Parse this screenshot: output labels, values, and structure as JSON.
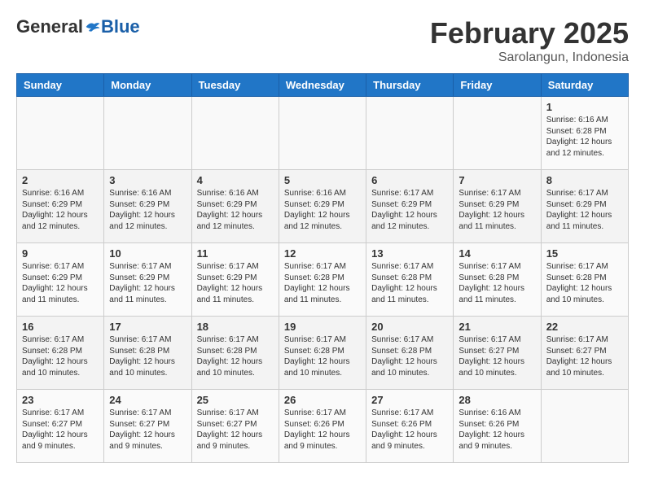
{
  "logo": {
    "general": "General",
    "blue": "Blue"
  },
  "header": {
    "month": "February 2025",
    "location": "Sarolangun, Indonesia"
  },
  "weekdays": [
    "Sunday",
    "Monday",
    "Tuesday",
    "Wednesday",
    "Thursday",
    "Friday",
    "Saturday"
  ],
  "weeks": [
    [
      {
        "day": "",
        "info": ""
      },
      {
        "day": "",
        "info": ""
      },
      {
        "day": "",
        "info": ""
      },
      {
        "day": "",
        "info": ""
      },
      {
        "day": "",
        "info": ""
      },
      {
        "day": "",
        "info": ""
      },
      {
        "day": "1",
        "info": "Sunrise: 6:16 AM\nSunset: 6:28 PM\nDaylight: 12 hours\nand 12 minutes."
      }
    ],
    [
      {
        "day": "2",
        "info": "Sunrise: 6:16 AM\nSunset: 6:29 PM\nDaylight: 12 hours\nand 12 minutes."
      },
      {
        "day": "3",
        "info": "Sunrise: 6:16 AM\nSunset: 6:29 PM\nDaylight: 12 hours\nand 12 minutes."
      },
      {
        "day": "4",
        "info": "Sunrise: 6:16 AM\nSunset: 6:29 PM\nDaylight: 12 hours\nand 12 minutes."
      },
      {
        "day": "5",
        "info": "Sunrise: 6:16 AM\nSunset: 6:29 PM\nDaylight: 12 hours\nand 12 minutes."
      },
      {
        "day": "6",
        "info": "Sunrise: 6:17 AM\nSunset: 6:29 PM\nDaylight: 12 hours\nand 12 minutes."
      },
      {
        "day": "7",
        "info": "Sunrise: 6:17 AM\nSunset: 6:29 PM\nDaylight: 12 hours\nand 11 minutes."
      },
      {
        "day": "8",
        "info": "Sunrise: 6:17 AM\nSunset: 6:29 PM\nDaylight: 12 hours\nand 11 minutes."
      }
    ],
    [
      {
        "day": "9",
        "info": "Sunrise: 6:17 AM\nSunset: 6:29 PM\nDaylight: 12 hours\nand 11 minutes."
      },
      {
        "day": "10",
        "info": "Sunrise: 6:17 AM\nSunset: 6:29 PM\nDaylight: 12 hours\nand 11 minutes."
      },
      {
        "day": "11",
        "info": "Sunrise: 6:17 AM\nSunset: 6:29 PM\nDaylight: 12 hours\nand 11 minutes."
      },
      {
        "day": "12",
        "info": "Sunrise: 6:17 AM\nSunset: 6:28 PM\nDaylight: 12 hours\nand 11 minutes."
      },
      {
        "day": "13",
        "info": "Sunrise: 6:17 AM\nSunset: 6:28 PM\nDaylight: 12 hours\nand 11 minutes."
      },
      {
        "day": "14",
        "info": "Sunrise: 6:17 AM\nSunset: 6:28 PM\nDaylight: 12 hours\nand 11 minutes."
      },
      {
        "day": "15",
        "info": "Sunrise: 6:17 AM\nSunset: 6:28 PM\nDaylight: 12 hours\nand 10 minutes."
      }
    ],
    [
      {
        "day": "16",
        "info": "Sunrise: 6:17 AM\nSunset: 6:28 PM\nDaylight: 12 hours\nand 10 minutes."
      },
      {
        "day": "17",
        "info": "Sunrise: 6:17 AM\nSunset: 6:28 PM\nDaylight: 12 hours\nand 10 minutes."
      },
      {
        "day": "18",
        "info": "Sunrise: 6:17 AM\nSunset: 6:28 PM\nDaylight: 12 hours\nand 10 minutes."
      },
      {
        "day": "19",
        "info": "Sunrise: 6:17 AM\nSunset: 6:28 PM\nDaylight: 12 hours\nand 10 minutes."
      },
      {
        "day": "20",
        "info": "Sunrise: 6:17 AM\nSunset: 6:28 PM\nDaylight: 12 hours\nand 10 minutes."
      },
      {
        "day": "21",
        "info": "Sunrise: 6:17 AM\nSunset: 6:27 PM\nDaylight: 12 hours\nand 10 minutes."
      },
      {
        "day": "22",
        "info": "Sunrise: 6:17 AM\nSunset: 6:27 PM\nDaylight: 12 hours\nand 10 minutes."
      }
    ],
    [
      {
        "day": "23",
        "info": "Sunrise: 6:17 AM\nSunset: 6:27 PM\nDaylight: 12 hours\nand 9 minutes."
      },
      {
        "day": "24",
        "info": "Sunrise: 6:17 AM\nSunset: 6:27 PM\nDaylight: 12 hours\nand 9 minutes."
      },
      {
        "day": "25",
        "info": "Sunrise: 6:17 AM\nSunset: 6:27 PM\nDaylight: 12 hours\nand 9 minutes."
      },
      {
        "day": "26",
        "info": "Sunrise: 6:17 AM\nSunset: 6:26 PM\nDaylight: 12 hours\nand 9 minutes."
      },
      {
        "day": "27",
        "info": "Sunrise: 6:17 AM\nSunset: 6:26 PM\nDaylight: 12 hours\nand 9 minutes."
      },
      {
        "day": "28",
        "info": "Sunrise: 6:16 AM\nSunset: 6:26 PM\nDaylight: 12 hours\nand 9 minutes."
      },
      {
        "day": "",
        "info": ""
      }
    ]
  ]
}
